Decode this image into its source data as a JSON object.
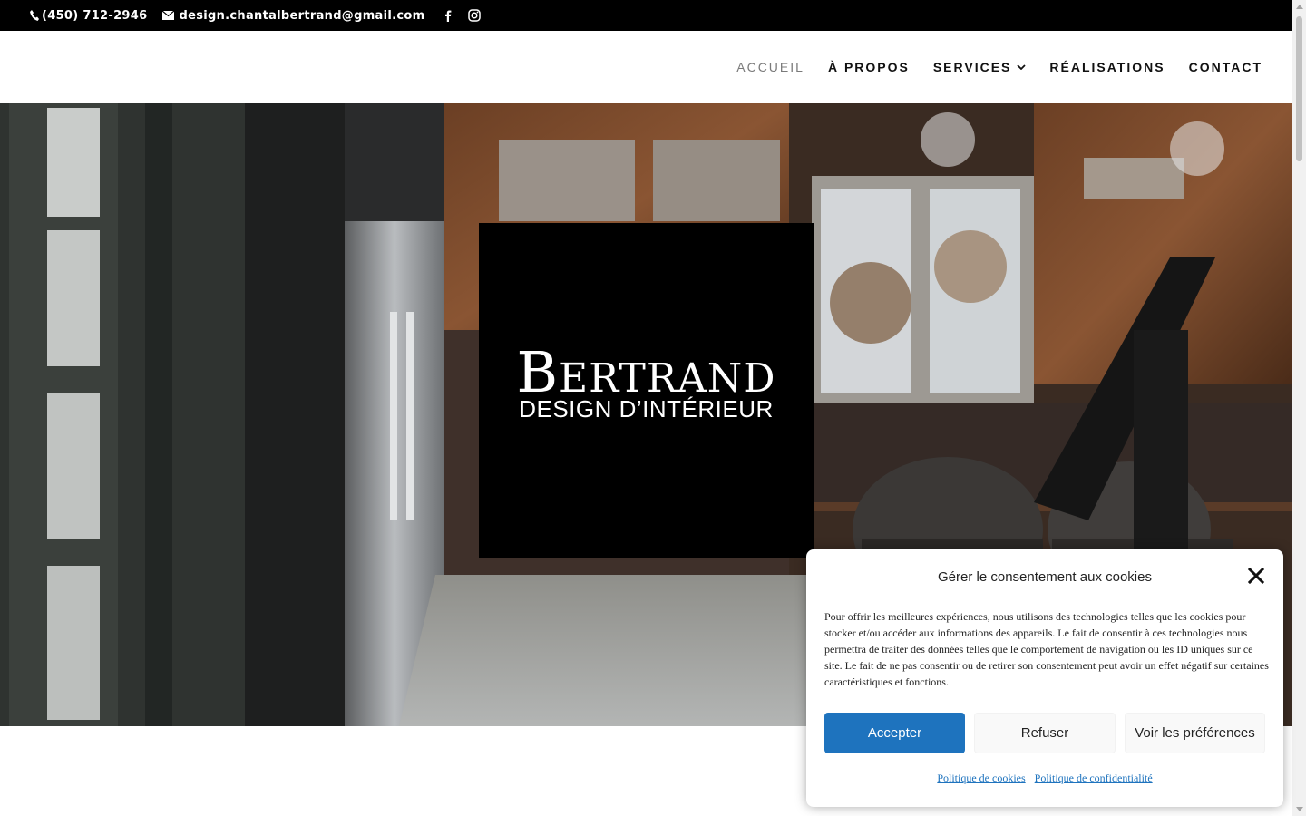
{
  "topbar": {
    "phone": "(450) 712-2946",
    "email": "design.chantalbertrand@gmail.com",
    "social": [
      "facebook-icon",
      "instagram-icon"
    ]
  },
  "nav": {
    "items": [
      {
        "label": "ACCUEIL",
        "active": true
      },
      {
        "label": "À PROPOS"
      },
      {
        "label": "SERVICES",
        "has_dropdown": true
      },
      {
        "label": "RÉALISATIONS"
      },
      {
        "label": "CONTACT"
      }
    ]
  },
  "hero": {
    "logo_main_first": "B",
    "logo_main_rest": "ERTRAND",
    "logo_sub": "DESIGN D’INTÉRIEUR"
  },
  "cookie": {
    "title": "Gérer le consentement aux cookies",
    "text": "Pour offrir les meilleures expériences, nous utilisons des technologies telles que les cookies pour stocker et/ou accéder aux informations des appareils. Le fait de consentir à ces technologies nous permettra de traiter des données telles que le comportement de navigation ou les ID uniques sur ce site. Le fait de ne pas consentir ou de retirer son consentement peut avoir un effet négatif sur certaines caractéristiques et fonctions.",
    "accept": "Accepter",
    "deny": "Refuser",
    "prefs": "Voir les préférences",
    "link_cookies": "Politique de cookies",
    "link_privacy": "Politique de confidentialité"
  },
  "colors": {
    "accent": "#1e73be",
    "topbar_bg": "#000000",
    "nav_active": "#7a7a7a"
  }
}
